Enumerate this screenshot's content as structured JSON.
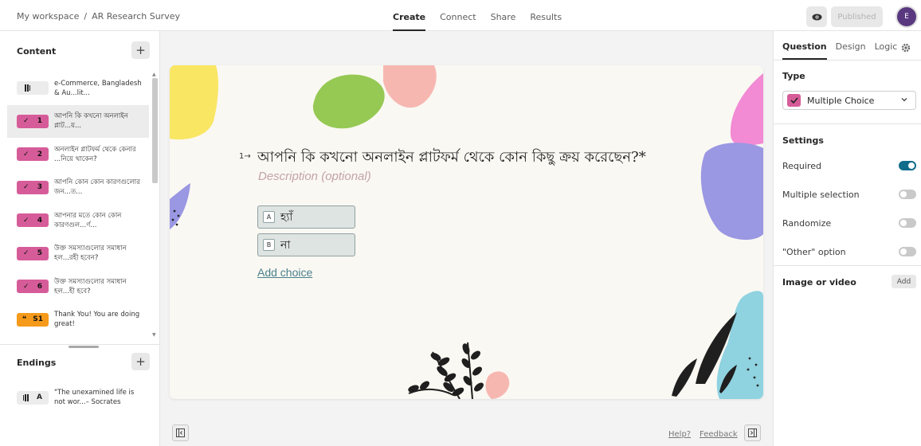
{
  "breadcrumb": {
    "workspace": "My workspace",
    "separator": "/",
    "form_name": "AR Research Survey"
  },
  "top_tabs": [
    {
      "label": "Create",
      "active": true
    },
    {
      "label": "Connect",
      "active": false
    },
    {
      "label": "Share",
      "active": false
    },
    {
      "label": "Results",
      "active": false
    }
  ],
  "header": {
    "preview_icon": "eye-icon",
    "publish_label": "Published",
    "avatar_initial": "E"
  },
  "sidebar": {
    "content_title": "Content",
    "add_label": "+",
    "items": [
      {
        "badge_num": "",
        "kind": "welcome",
        "text": "e-Commerce, Bangladesh & Au...lit..."
      },
      {
        "badge_num": "1",
        "kind": "mc",
        "text": "আপনি কি কখনো অনলাইন প্লাট...য়...",
        "selected": true
      },
      {
        "badge_num": "2",
        "kind": "mc",
        "text": "অনলাইন প্লাটফর্ম থেকে কেনার ...নিয়ে থাকেন?"
      },
      {
        "badge_num": "3",
        "kind": "mc",
        "text": "আপনি কোন কোন কারণগুলোর জন...ত..."
      },
      {
        "badge_num": "4",
        "kind": "mc",
        "text": "আপনার মতে কোন কোন কারণগুল...র্ণ..."
      },
      {
        "badge_num": "5",
        "kind": "mc",
        "text": "উক্ত সমস্যাগুলোর সমাধান হল...রহী হবেন?"
      },
      {
        "badge_num": "6",
        "kind": "mc",
        "text": "উক্ত সমস্যাগুলোর সমাধান হল...হী হবে?"
      },
      {
        "badge_num": "S1",
        "kind": "stmt",
        "text": "Thank You! You are doing great!"
      }
    ],
    "endings_title": "Endings",
    "ending": {
      "badge_letter": "A",
      "text": "\"The unexamined life is not wor...– Socrates"
    }
  },
  "question": {
    "number": "1→",
    "title": "আপনি কি কখনো অনলাইন প্লাটফর্ম থেকে কোন কিছু ক্রয় করেছেন?*",
    "description_placeholder": "Description (optional)",
    "choices": [
      {
        "key": "A",
        "label": "হ্যাঁ"
      },
      {
        "key": "B",
        "label": "না"
      }
    ],
    "add_choice_label": "Add choice"
  },
  "footer": {
    "help_label": "Help?",
    "feedback_label": "Feedback"
  },
  "right_panel": {
    "tabs": [
      {
        "label": "Question",
        "active": true
      },
      {
        "label": "Design",
        "active": false
      },
      {
        "label": "Logic",
        "active": false
      }
    ],
    "type_label": "Type",
    "type_value": "Multiple Choice",
    "settings_label": "Settings",
    "settings": [
      {
        "label": "Required",
        "on": true
      },
      {
        "label": "Multiple selection",
        "on": false
      },
      {
        "label": "Randomize",
        "on": false
      },
      {
        "label": "\"Other\" option",
        "on": false
      }
    ],
    "image_video_label": "Image or video",
    "image_add_label": "Add"
  },
  "colors": {
    "accent_mc": "#d65c99",
    "statement": "#f59a1a",
    "toggle_on": "#0f6c8a",
    "link": "#4a7f8c"
  }
}
